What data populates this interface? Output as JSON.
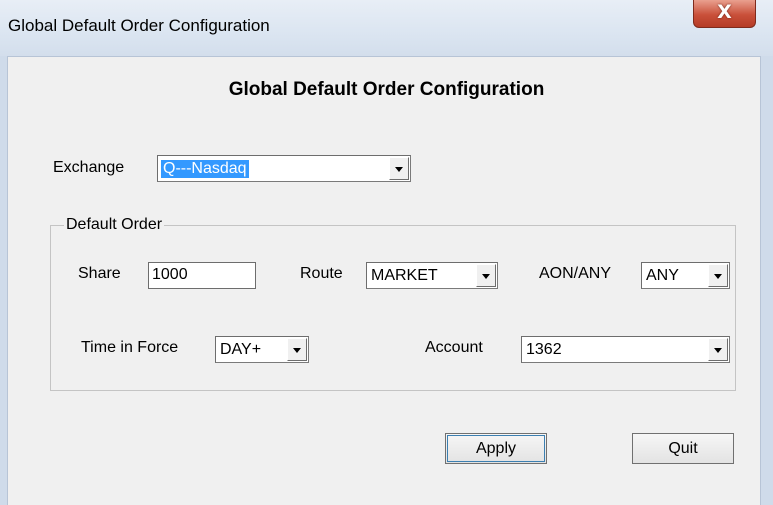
{
  "window": {
    "title": "Global Default Order Configuration",
    "close_glyph": "X"
  },
  "heading": "Global Default Order Configuration",
  "exchange": {
    "label": "Exchange",
    "value": "Q---Nasdaq"
  },
  "default_order": {
    "legend": "Default Order",
    "share": {
      "label": "Share",
      "value": "1000"
    },
    "route": {
      "label": "Route",
      "value": "MARKET"
    },
    "aon_any": {
      "label": "AON/ANY",
      "value": "ANY"
    },
    "time_in_force": {
      "label": "Time in Force",
      "value": "DAY+"
    },
    "account": {
      "label": "Account",
      "value": "1362"
    }
  },
  "buttons": {
    "apply": "Apply",
    "quit": "Quit"
  },
  "colors": {
    "selection": "#3399ff",
    "close_button": "#c9503a",
    "titlebar": "#dbe5f1"
  }
}
